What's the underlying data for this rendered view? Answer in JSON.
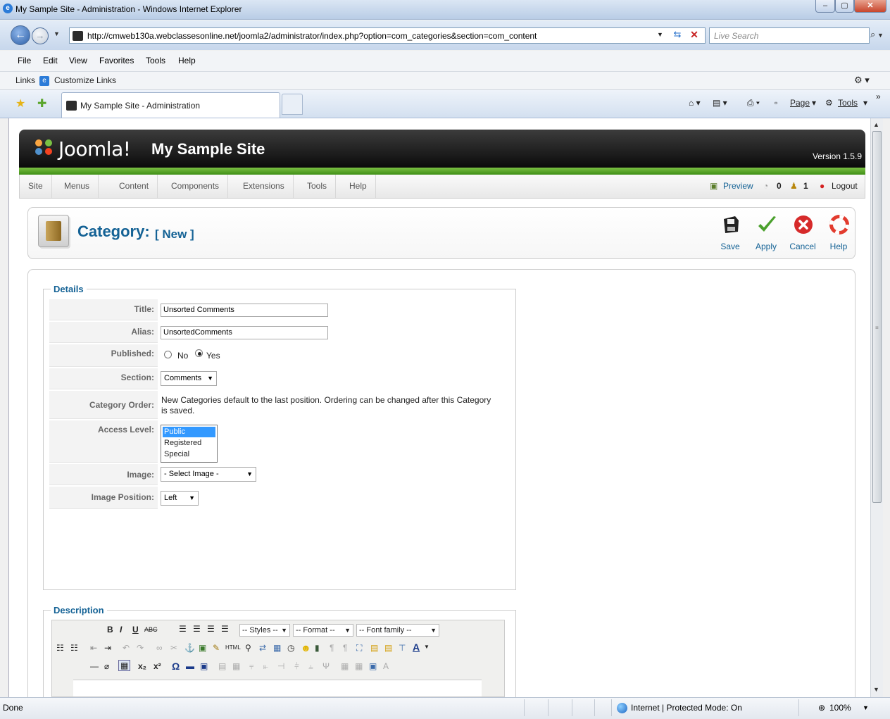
{
  "window": {
    "title": "My Sample Site - Administration - Windows Internet Explorer"
  },
  "browser": {
    "url": "http://cmweb130a.webclassesonline.net/joomla2/administrator/index.php?option=com_categories&section=com_content",
    "search_placeholder": "Live Search",
    "menu": [
      "File",
      "Edit",
      "View",
      "Favorites",
      "Tools",
      "Help"
    ],
    "links_label": "Links",
    "customize_links": "Customize Links",
    "tab_title": "My Sample Site - Administration",
    "commands": {
      "page": "Page",
      "tools": "Tools"
    }
  },
  "joomla": {
    "brand": "Joomla!",
    "site_name": "My Sample Site",
    "version": "Version 1.5.9",
    "menu": [
      "Site",
      "Menus",
      "Content",
      "Components",
      "Extensions",
      "Tools",
      "Help"
    ],
    "preview": "Preview",
    "messages_count": "0",
    "users_count": "1",
    "logout": "Logout"
  },
  "page": {
    "title": "Category:",
    "subtitle": "[ New ]",
    "toolbar": [
      "Save",
      "Apply",
      "Cancel",
      "Help"
    ]
  },
  "details": {
    "legend": "Details",
    "fields": {
      "title_label": "Title:",
      "title_value": "Unsorted Comments",
      "alias_label": "Alias:",
      "alias_value": "UnsortedComments",
      "published_label": "Published:",
      "published_no": "No",
      "published_yes": "Yes",
      "section_label": "Section:",
      "section_value": "Comments",
      "order_label": "Category Order:",
      "order_text": "New Categories default to the last position. Ordering can be changed after this Category is saved.",
      "access_label": "Access Level:",
      "access_options": [
        "Public",
        "Registered",
        "Special"
      ],
      "image_label": "Image:",
      "image_value": "- Select Image -",
      "image_position_label": "Image Position:",
      "image_position_value": "Left"
    }
  },
  "description": {
    "legend": "Description",
    "styles": "-- Styles --",
    "format": "-- Format --",
    "font_family": "-- Font family --"
  },
  "status": {
    "text": "Done",
    "zone": "Internet | Protected Mode: On",
    "zoom": "100%"
  },
  "colors": {
    "joomla_blue": "#146295",
    "joomla_green": "#5aab2a",
    "header_black": "#111111"
  }
}
